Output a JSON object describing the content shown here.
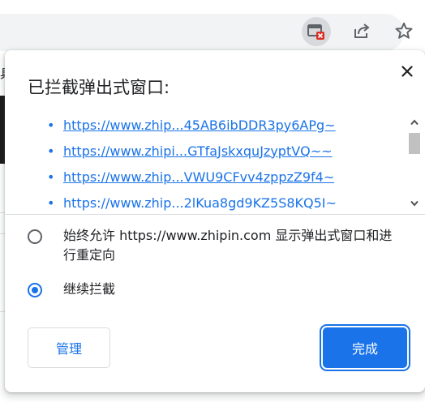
{
  "toolbar": {
    "icons": [
      "popup-blocked-icon",
      "share-icon",
      "star-icon"
    ]
  },
  "page": {
    "edge_char": "具"
  },
  "bubble": {
    "title": "已拦截弹出式窗口:",
    "urls": [
      "https://www.zhip...45AB6ibDDR3py6APg~",
      "https://www.zhipi...GTfaJskxquJzyptVQ~~",
      "https://www.zhip...VWU9CFvv4zppzZ9f4~",
      "https://www.zhip...2lKua8gd9KZ5S8KQ5I~"
    ],
    "options": {
      "allow_label": "始终允许 https://www.zhipin.com 显示弹出式窗口和进行重定向",
      "block_label": "继续拦截",
      "selected": "block"
    },
    "manage_label": "管理",
    "done_label": "完成"
  },
  "colors": {
    "accent": "#1a73e8",
    "blocked_badge": "#d93025"
  }
}
